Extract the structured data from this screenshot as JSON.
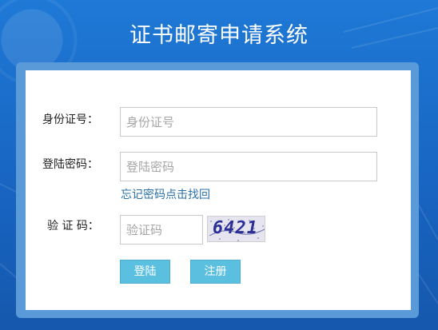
{
  "header": {
    "title": "证书邮寄申请系统"
  },
  "form": {
    "id_label": "身份证号：",
    "id_placeholder": "身份证号",
    "password_label": "登陆密码：",
    "password_placeholder": "登陆密码",
    "forgot_link": "忘记密码点击找回",
    "captcha_label": "验 证 码：",
    "captcha_placeholder": "验证码",
    "captcha_code": "6421",
    "login_button": "登陆",
    "register_button": "注册"
  },
  "colors": {
    "background": "#1a6cc9",
    "button": "#5bbfdf",
    "link": "#2a70a8"
  }
}
